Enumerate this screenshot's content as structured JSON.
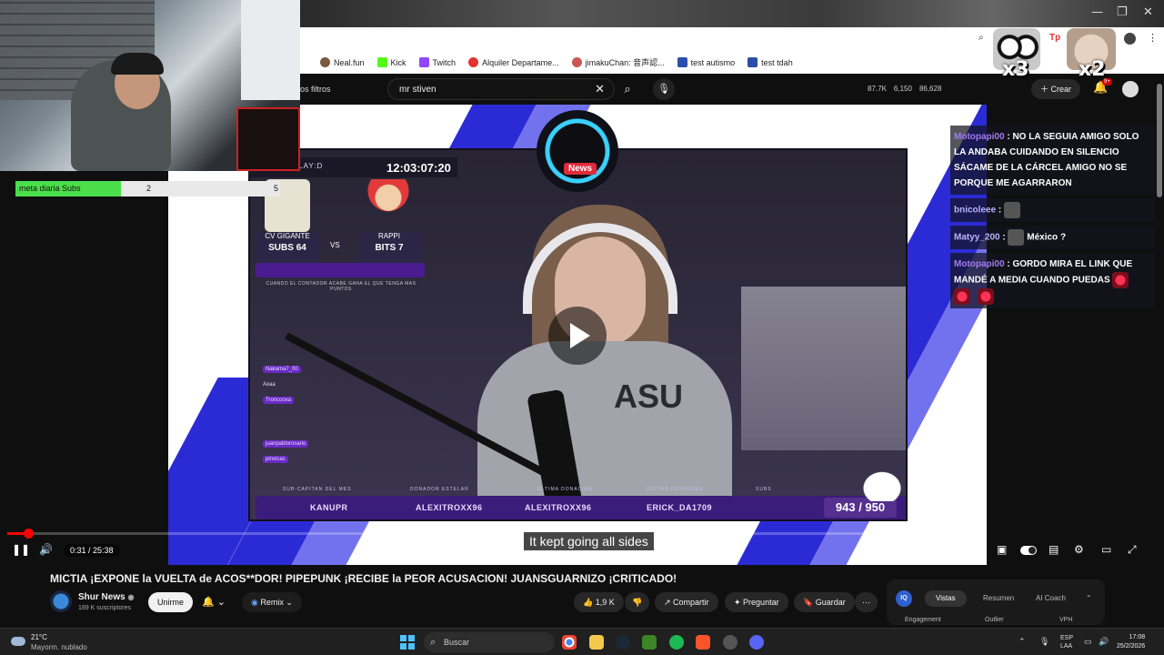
{
  "browser": {
    "bookmarks": [
      "Neal.fun",
      "Kick",
      "Twitch",
      "Alquiler Departame...",
      "jimakuChan: 音声認...",
      "test autismo",
      "test tdah"
    ]
  },
  "webcam_overlay": {
    "goal_label": "meta diaria Subs",
    "goal_current": "2",
    "goal_target": "5",
    "goal_fraction": 0.4
  },
  "masthead": {
    "filters_label": "os filtros",
    "search_value": "mr stiven",
    "stats": [
      "87.7K",
      "6,150",
      "86,628"
    ],
    "create_label": "Crear",
    "notif_badge": "9+"
  },
  "emote_overlays": [
    {
      "multiplier": "x3"
    },
    {
      "multiplier": "x2"
    }
  ],
  "stream_overlay": {
    "timer_label": "ENTE COSPLAY:D",
    "timer": "12:03:07:20",
    "logo_badge": "News",
    "contest": {
      "left_name": "CV GIGANTE",
      "left_metric": "SUBS",
      "left_score": "64",
      "vs": "VS",
      "right_name": "RAPPI",
      "right_metric": "BITS",
      "right_score": "7",
      "note": "CUANDO EL CONTADOR ACABE GANA EL QUE TENGA MAS PUNTOS"
    },
    "mini_chat": [
      "Nakama7_00",
      "Axaa",
      "Troncooxa",
      "juanpablorosario",
      "pinvicas"
    ],
    "bottom_bar": {
      "headers": [
        "SUB-CAPITAN DEL MES",
        "DONADOR ESTELAR",
        "ULTIMA DONACION",
        "ULTIMO DESPEGUE",
        "SUBS"
      ],
      "values": [
        "KANUPR",
        "ALEXITROXX96",
        "ALEXITROXX96",
        "ERICK_DA1709"
      ],
      "subs": "943 / 950"
    },
    "girl_shirt_text": "ASU"
  },
  "player": {
    "time": "0:31 / 25:38",
    "progress_fraction": 0.02,
    "caption": "It kept going all sides"
  },
  "chat_overlay": [
    {
      "user": "Motopapi00",
      "text": "NO LA SEGUIA AMIGO SOLO LA ANDABA CUIDANDO EN SILENCIO SÁCAME DE LA CÁRCEL AMIGO NO SE PORQUE ME AGARRARON"
    },
    {
      "user": "bnicoleee",
      "text": ""
    },
    {
      "user": "Matyy_200",
      "text": "México ?"
    },
    {
      "user": "Motopapi00",
      "text": "GORDO MIRA EL LINK QUE MANDÉ A MEDIA CUANDO PUEDAS"
    }
  ],
  "video": {
    "title": "MICTIA ¡EXPONE la VUELTA de ACOS**DOR! PIPEPUNK ¡RECIBE la PEOR ACUSACION! JUANSGUARNIZO ¡CRITICADO!",
    "channel": "Shur News",
    "subscribers": "189 K suscriptores",
    "join_label": "Unirme",
    "remix_label": "Remix",
    "likes": "1,9 K",
    "share_label": "Compartir",
    "ask_label": "Preguntar",
    "save_label": "Guardar"
  },
  "side_panel": {
    "badge": "IQ",
    "tabs": [
      "Vistas",
      "Resumen",
      "AI Coach"
    ],
    "columns": [
      "Engagement",
      "Outlier",
      "VPH"
    ]
  },
  "taskbar": {
    "temp": "21°C",
    "weather": "Mayorm. nublado",
    "search": "Buscar",
    "lang1": "ESP",
    "lang2": "LAA",
    "time": "17:08",
    "date": "25/2/2026"
  }
}
